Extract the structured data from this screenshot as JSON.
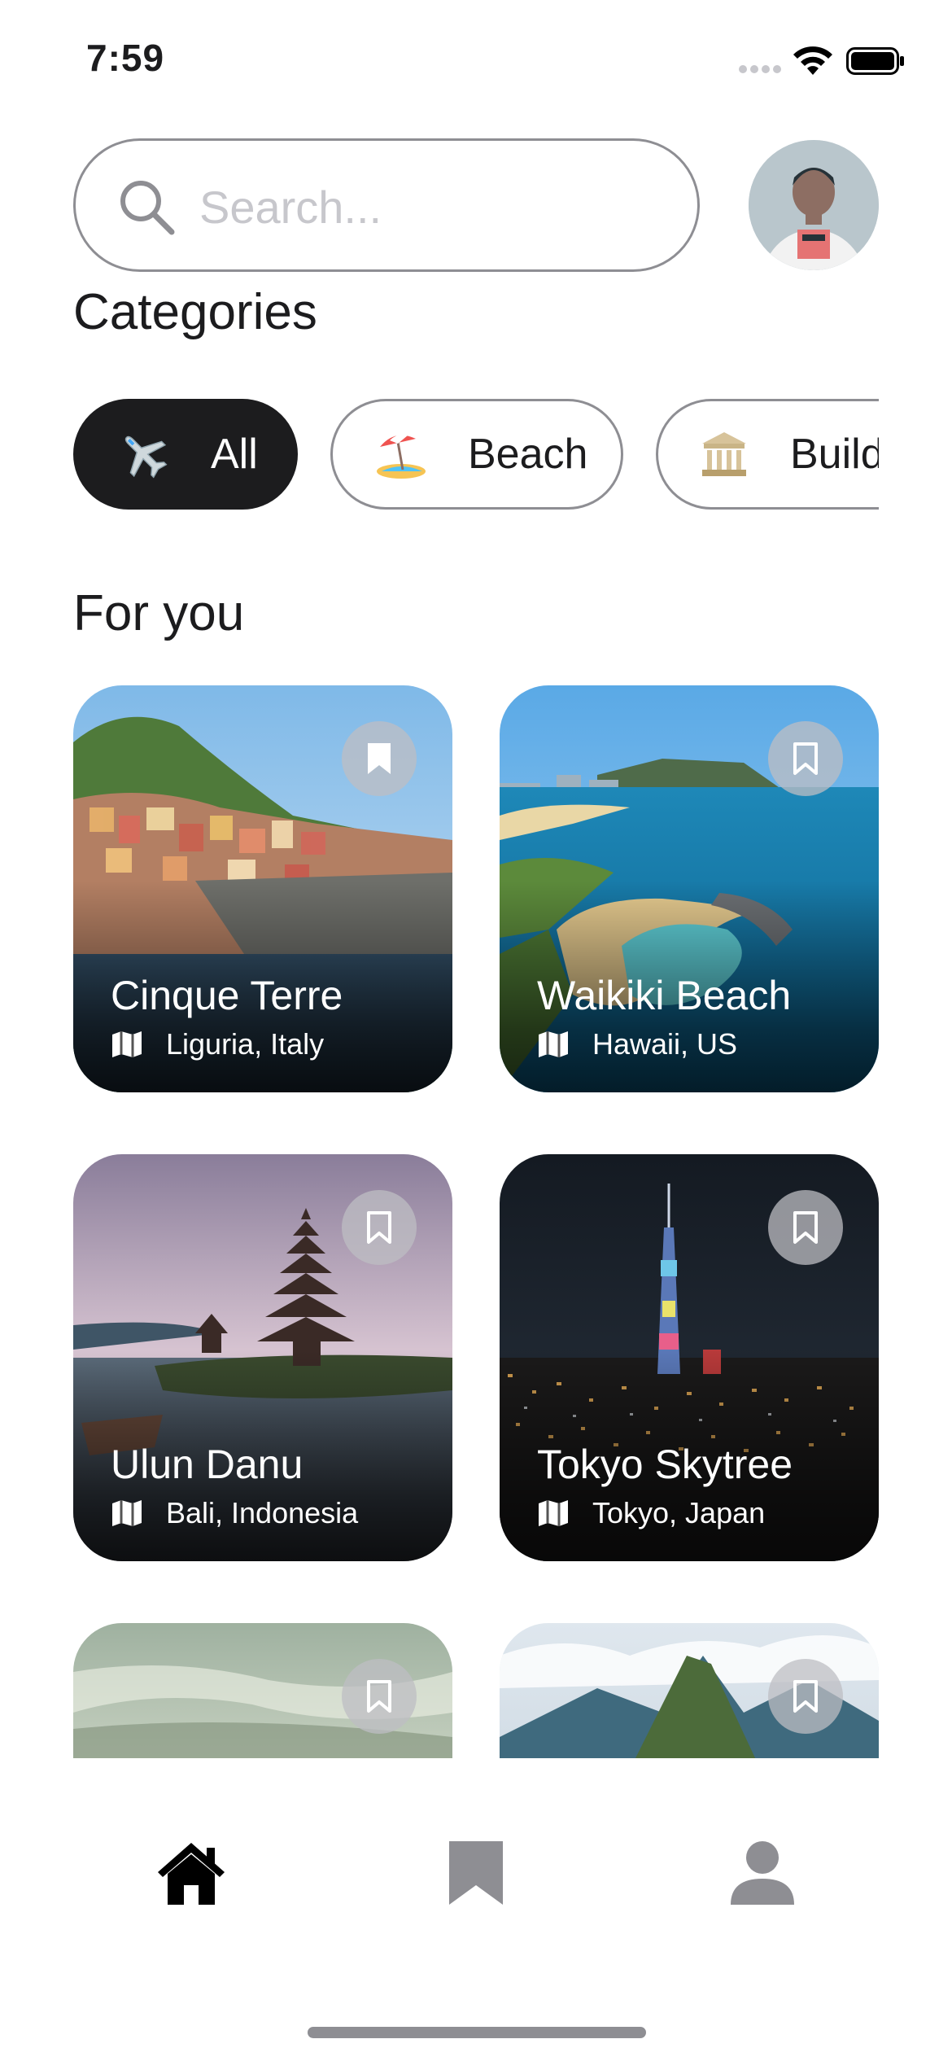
{
  "status_bar": {
    "time": "7:59"
  },
  "search": {
    "placeholder": "Search..."
  },
  "profile": {
    "avatar_alt": "user avatar"
  },
  "categories": {
    "title": "Categories",
    "items": [
      {
        "label": "All",
        "icon": "airplane-icon",
        "selected": true
      },
      {
        "label": "Beach",
        "icon": "beach-umbrella-icon",
        "selected": false
      },
      {
        "label": "Buildings",
        "icon": "classical-building-icon",
        "selected": false
      }
    ]
  },
  "for_you": {
    "title": "For you",
    "places": [
      {
        "name": "Cinque Terre",
        "location": "Liguria, Italy"
      },
      {
        "name": "Waikiki Beach",
        "location": "Hawaii, US"
      },
      {
        "name": "Ulun Danu",
        "location": "Bali, Indonesia"
      },
      {
        "name": "Tokyo Skytree",
        "location": "Tokyo, Japan"
      },
      {
        "name": "",
        "location": ""
      },
      {
        "name": "",
        "location": ""
      }
    ]
  },
  "tab_bar": {
    "items": [
      {
        "icon": "home-icon",
        "active": true
      },
      {
        "icon": "bookmark-icon",
        "active": false
      },
      {
        "icon": "person-icon",
        "active": false
      }
    ]
  },
  "colors": {
    "accent": "#1c1c1e",
    "inactive": "#8e8e93",
    "background": "#ffffff"
  }
}
